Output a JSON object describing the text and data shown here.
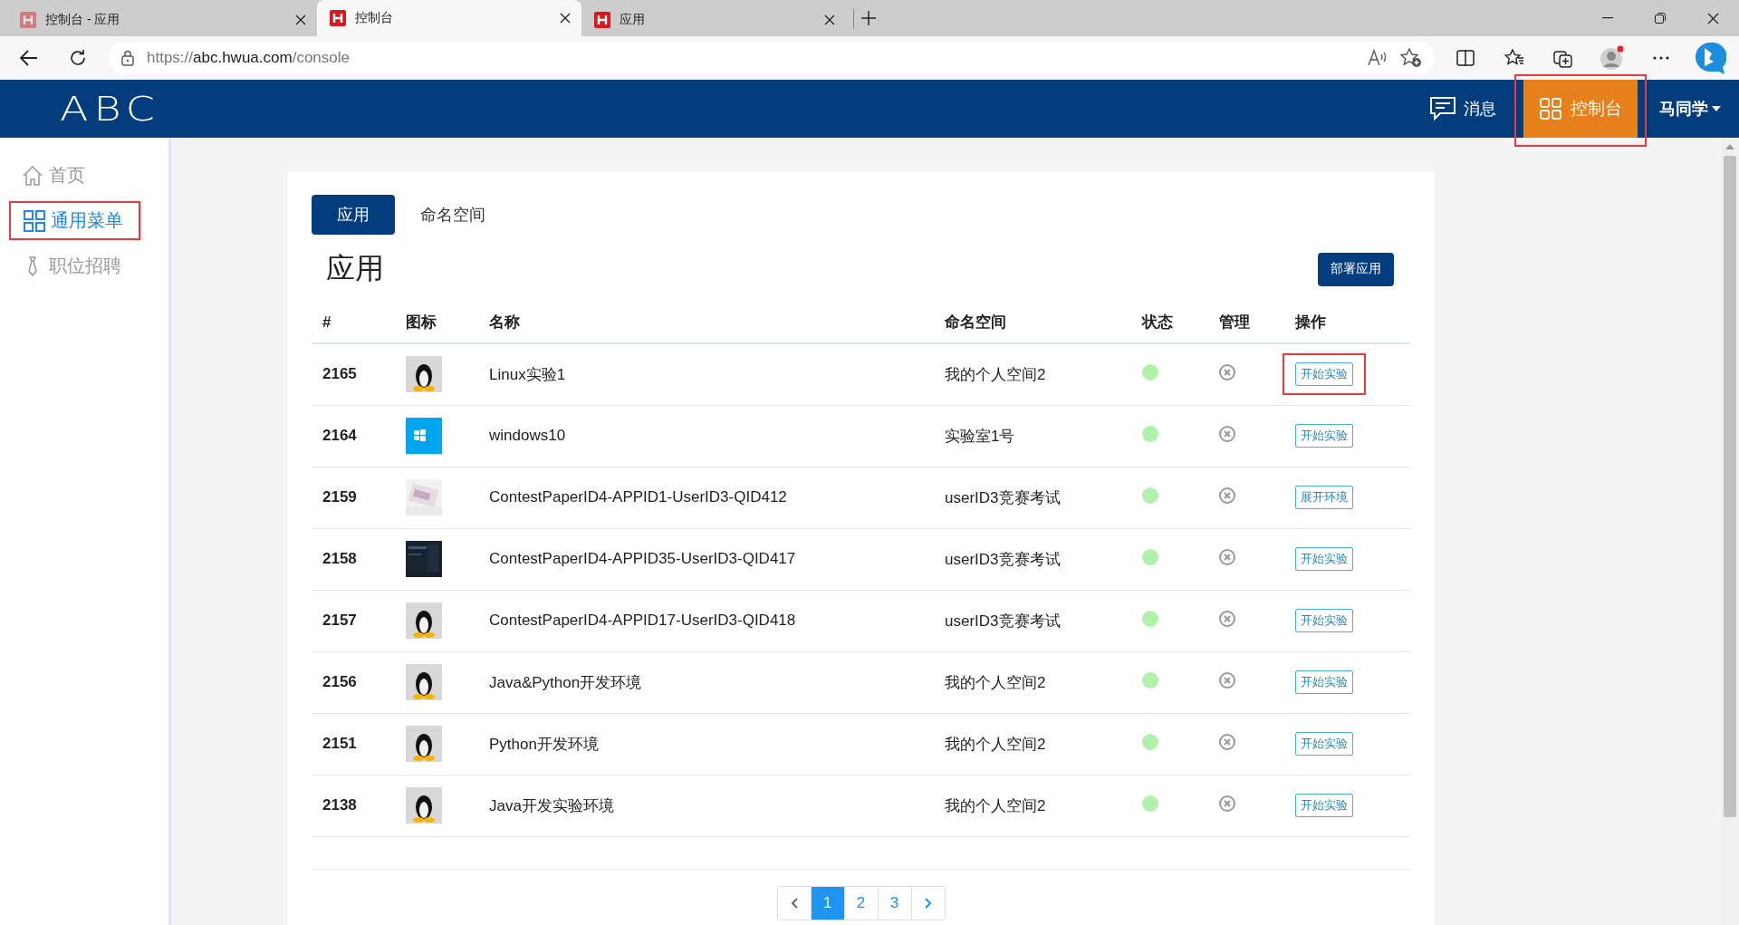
{
  "browser": {
    "tabs": [
      {
        "title": "控制台 - 应用",
        "selected": false,
        "faded": true
      },
      {
        "title": "控制台",
        "selected": true,
        "faded": false
      },
      {
        "title": "应用",
        "selected": false,
        "faded": false
      }
    ],
    "url": {
      "scheme": "https://",
      "host": "abc.hwua.com",
      "path": "/console"
    }
  },
  "header": {
    "logo": "ABC",
    "messages": "消息",
    "console": {
      "label": "控制台",
      "selected": true,
      "annotated": true
    },
    "user": "马同学"
  },
  "sidebar": {
    "items": [
      {
        "kind": "home",
        "label": "首页",
        "selected": false,
        "annotated": false
      },
      {
        "kind": "grid",
        "label": "通用菜单",
        "selected": true,
        "annotated": true
      },
      {
        "kind": "tie",
        "label": "职位招聘",
        "selected": false,
        "annotated": false
      }
    ]
  },
  "content": {
    "tabs": [
      {
        "label": "应用",
        "selected": true
      },
      {
        "label": "命名空间",
        "selected": false
      }
    ],
    "title": "应用",
    "deploy_button": "部署应用",
    "table": {
      "columns": [
        "#",
        "图标",
        "名称",
        "命名空间",
        "状态",
        "管理",
        "操作"
      ],
      "rows": [
        {
          "id": "2165",
          "name": "Linux实验1",
          "namespace": "我的个人空间2",
          "status": {
            "color": "#b0f2ab"
          },
          "action": "开始实验",
          "annotated": true
        },
        {
          "id": "2164",
          "name": "windows10",
          "namespace": "实验室1号",
          "status": {
            "color": "#b0f2ab"
          },
          "action": "开始实验",
          "annotated": false
        },
        {
          "id": "2159",
          "name": "ContestPaperID4-APPID1-UserID3-QID412",
          "namespace": "userID3竞赛考试",
          "status": {
            "color": "#b0f2ab"
          },
          "action": "展开环境",
          "annotated": false
        },
        {
          "id": "2158",
          "name": "ContestPaperID4-APPID35-UserID3-QID417",
          "namespace": "userID3竞赛考试",
          "status": {
            "color": "#b0f2ab"
          },
          "action": "开始实验",
          "annotated": false
        },
        {
          "id": "2157",
          "name": "ContestPaperID4-APPID17-UserID3-QID418",
          "namespace": "userID3竞赛考试",
          "status": {
            "color": "#b0f2ab"
          },
          "action": "开始实验",
          "annotated": false
        },
        {
          "id": "2156",
          "name": "Java&Python开发环境",
          "namespace": "我的个人空间2",
          "status": {
            "color": "#b0f2ab"
          },
          "action": "开始实验",
          "annotated": false
        },
        {
          "id": "2151",
          "name": "Python开发环境",
          "namespace": "我的个人空间2",
          "status": {
            "color": "#b0f2ab"
          },
          "action": "开始实验",
          "annotated": false
        },
        {
          "id": "2138",
          "name": "Java开发实验环境",
          "namespace": "我的个人空间2",
          "status": {
            "color": "#b0f2ab"
          },
          "action": "开始实验",
          "annotated": false
        }
      ]
    },
    "pagination": {
      "pages": [
        {
          "label": "1",
          "selected": true
        },
        {
          "label": "2",
          "selected": false
        },
        {
          "label": "3",
          "selected": false
        }
      ]
    }
  }
}
